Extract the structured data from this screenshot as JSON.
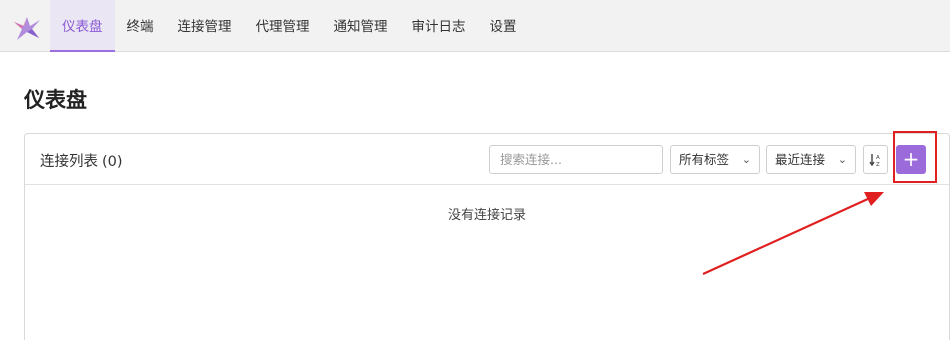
{
  "nav": {
    "items": [
      {
        "label": "仪表盘",
        "active": true
      },
      {
        "label": "终端"
      },
      {
        "label": "连接管理"
      },
      {
        "label": "代理管理"
      },
      {
        "label": "通知管理"
      },
      {
        "label": "审计日志"
      },
      {
        "label": "设置"
      }
    ]
  },
  "page": {
    "title": "仪表盘"
  },
  "connections": {
    "title": "连接列表",
    "count": "(0)",
    "search_placeholder": "搜索连接...",
    "tag_filter": "所有标签",
    "sort_select": "最近连接",
    "add_label": "+",
    "empty_text": "没有连接记录"
  },
  "colors": {
    "accent": "#9b6bdc",
    "annotation": "#e02020"
  },
  "icons": {
    "logo": "app-logo-icon",
    "sort": "sort-descending-icon",
    "chevron": "chevron-down-icon"
  }
}
